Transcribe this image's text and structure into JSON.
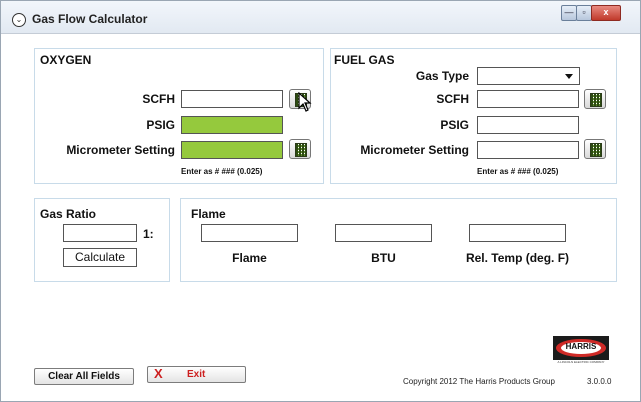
{
  "window": {
    "title": "Gas Flow Calculator",
    "min_label": "—",
    "max_label": "▫",
    "close_label": "x"
  },
  "oxygen": {
    "title": "OXYGEN",
    "scfh_label": "SCFH",
    "psig_label": "PSIG",
    "micrometer_label": "Micrometer Setting",
    "hint": "Enter as # ### (0.025)"
  },
  "fuel": {
    "title": "FUEL GAS",
    "gas_type_label": "Gas Type",
    "scfh_label": "SCFH",
    "psig_label": "PSIG",
    "micrometer_label": "Micrometer Setting",
    "hint": "Enter as # ### (0.025)"
  },
  "ratio": {
    "title": "Gas Ratio",
    "suffix": "1:",
    "calculate_label": "Calculate"
  },
  "flame": {
    "title": "Flame",
    "col1_label": "Flame",
    "col2_label": "BTU",
    "col3_label": "Rel. Temp (deg. F)"
  },
  "footer": {
    "clear_label": "Clear All Fields",
    "exit_label": "Exit",
    "exit_icon": "X",
    "copyright": "Copyright 2012 The Harris Products Group",
    "version": "3.0.0.0",
    "logo_text": "HARRIS",
    "logo_subtext": "A LINCOLN ELECTRIC COMPANY"
  },
  "colors": {
    "green_field": "#95c93d",
    "panel_border": "#c8dbe9",
    "exit_x": "#cc1f1f"
  }
}
